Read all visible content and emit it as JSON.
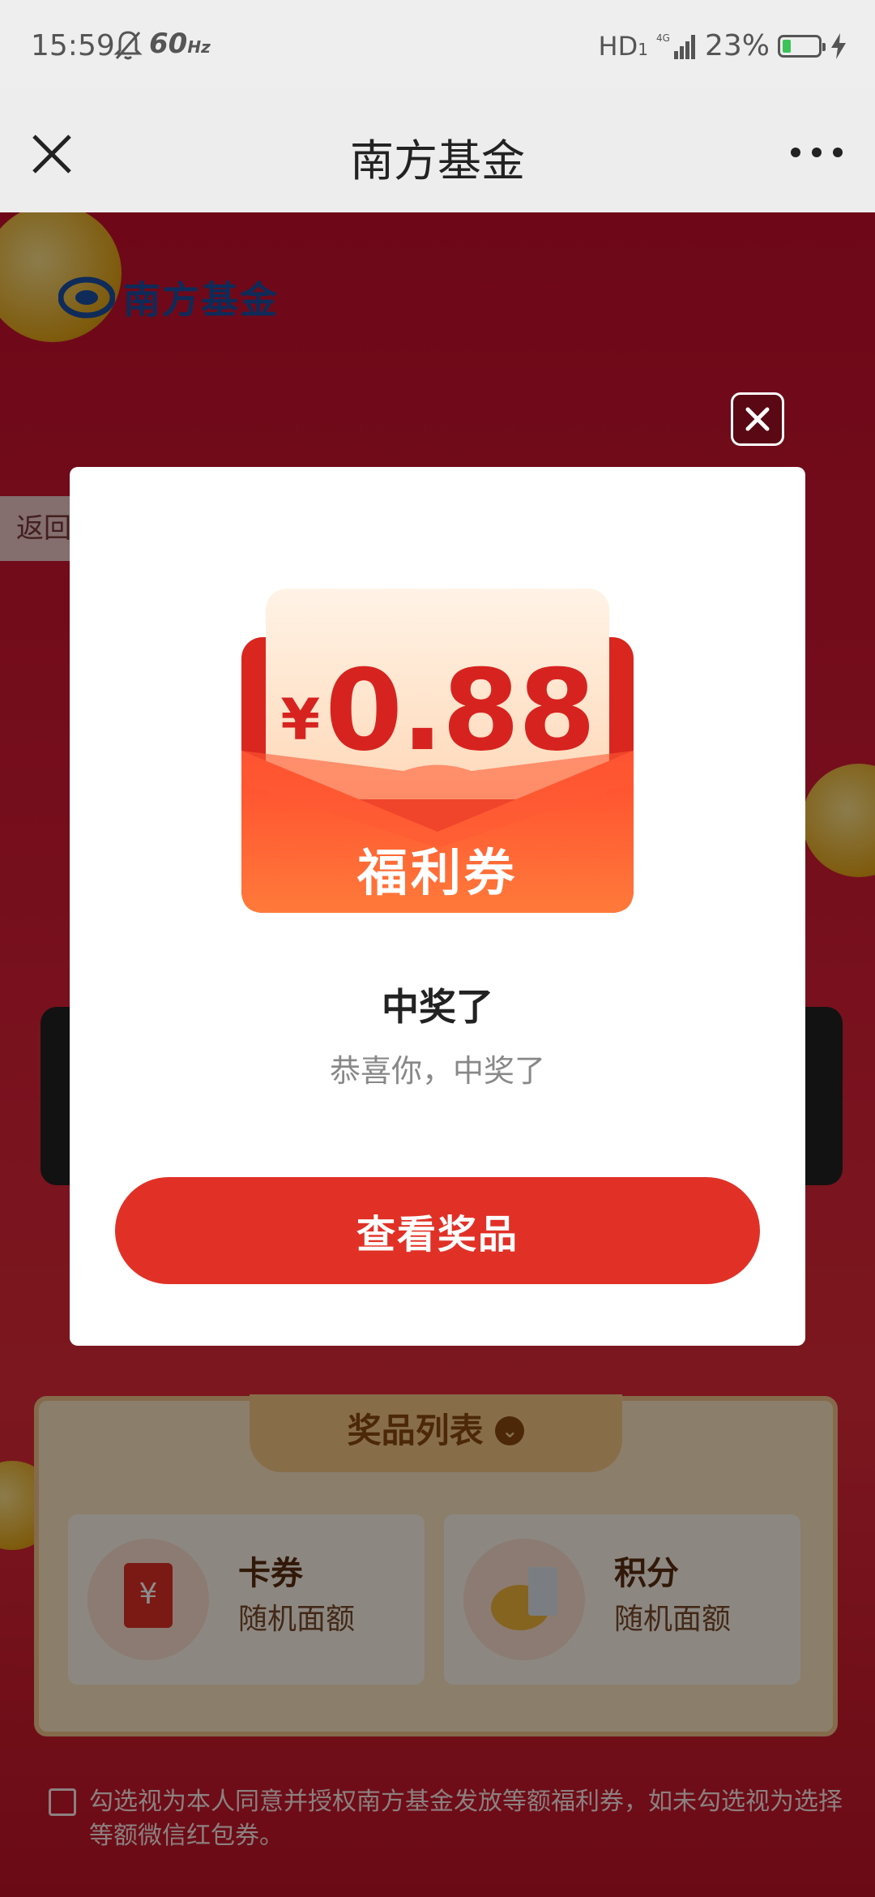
{
  "status_bar": {
    "time": "15:59",
    "refresh_rate": "60",
    "refresh_unit": "Hz",
    "hd_label": "HD",
    "hd_sub": "1",
    "network": "4G",
    "battery_percent": "23%",
    "battery_level": 0.23,
    "battery_color": "#3bc35a"
  },
  "title_bar": {
    "title": "南方基金",
    "close_icon": "close-icon",
    "more_icon": "more-icon"
  },
  "background": {
    "logo_text": "南方基金",
    "back_label": "返回",
    "prize_list_title": "奖品列表",
    "prizes": [
      {
        "name": "卡券",
        "desc": "随机面额",
        "icon": "red-envelope-icon"
      },
      {
        "name": "积分",
        "desc": "随机面额",
        "icon": "coin-icon"
      }
    ],
    "agreement": "勾选视为本人同意并授权南方基金发放等额福利券，如未勾选视为选择等额微信红包券。"
  },
  "modal": {
    "currency": "¥",
    "amount": "0.88",
    "coupon_label": "福利券",
    "title": "中奖了",
    "subtitle": "恭喜你，中奖了",
    "button_label": "查看奖品",
    "accent_color": "#e13127"
  }
}
